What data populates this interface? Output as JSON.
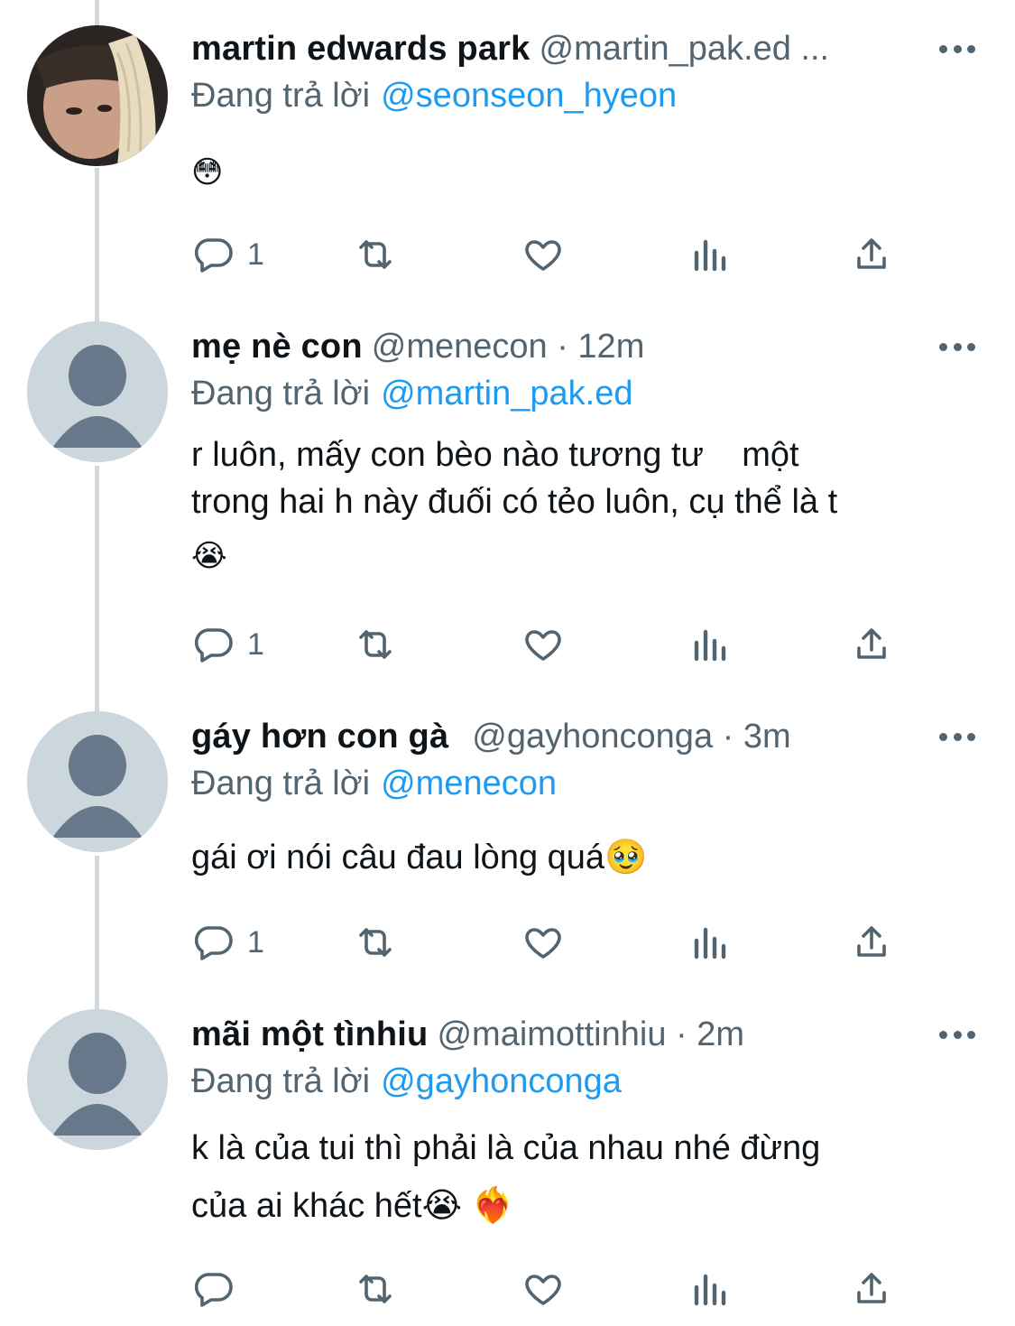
{
  "tweets": [
    {
      "name": "martin edwards park",
      "handle": "@martin_pak.ed ...",
      "time": "",
      "reply_prefix": "Đang trả lời",
      "reply_to": "@seonseon_hyeon",
      "text_lines": [],
      "emoji_line": "😳",
      "reply_count": "1",
      "has_photo": true
    },
    {
      "name": "mẹ nè con",
      "handle": "@menecon",
      "time": " · 12m",
      "reply_prefix": "Đang trả lời",
      "reply_to": "@martin_pak.ed",
      "text_lines": [
        "r luôn, mấy con bèo nào tương tư    một",
        "trong hai h này đuối có tẻo luôn, cụ thể là t"
      ],
      "emoji_line": "😭",
      "reply_count": "1",
      "has_photo": false
    },
    {
      "name": "gáy hơn con gà",
      "handle": "@gayhonconga",
      "time": " · 3m",
      "reply_prefix": "Đang trả lời",
      "reply_to": "@menecon",
      "text_lines": [
        "gái ơi nói câu đau lòng quá🥹"
      ],
      "emoji_line": "",
      "reply_count": "1",
      "has_photo": false
    },
    {
      "name": "mãi một tìnhiu",
      "handle": "@maimottinhiu",
      "time": " · 2m",
      "reply_prefix": "Đang trả lời",
      "reply_to": "@gayhonconga",
      "text_lines": [
        "k là của tui thì phải là của nhau nhé đừng",
        "của ai khác hết😭 ❤️‍🔥"
      ],
      "emoji_line": "",
      "reply_count": "",
      "has_photo": false
    }
  ],
  "icons": {
    "reply": "reply-icon",
    "retweet": "retweet-icon",
    "like": "heart-icon",
    "views": "views-icon",
    "share": "share-icon",
    "more": "more-icon"
  },
  "colors": {
    "link": "#1d9bf0",
    "secondary_text": "#536471",
    "thread_line": "#cfd9de",
    "default_avatar_bg": "#ccd6dd",
    "default_avatar_fg": "#66788a"
  }
}
